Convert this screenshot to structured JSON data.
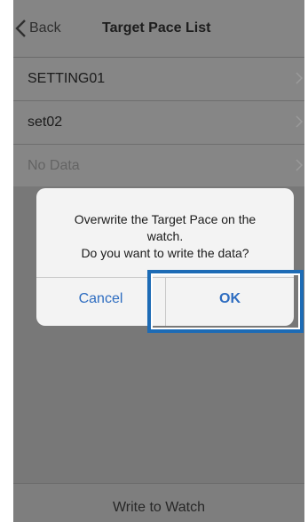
{
  "nav": {
    "back_label": "Back",
    "title": "Target Pace List"
  },
  "list": {
    "items": [
      {
        "label": "SETTING01"
      },
      {
        "label": "set02"
      },
      {
        "label": "No Data"
      }
    ]
  },
  "alert": {
    "message_line1": "Overwrite the Target Pace on the",
    "message_line2": "watch.",
    "message_line3": "Do you want to write the data?",
    "cancel_label": "Cancel",
    "ok_label": "OK"
  },
  "toolbar": {
    "write_label": "Write to Watch"
  },
  "colors": {
    "accent": "#2d6cc0",
    "highlight": "#1d6bb5"
  }
}
